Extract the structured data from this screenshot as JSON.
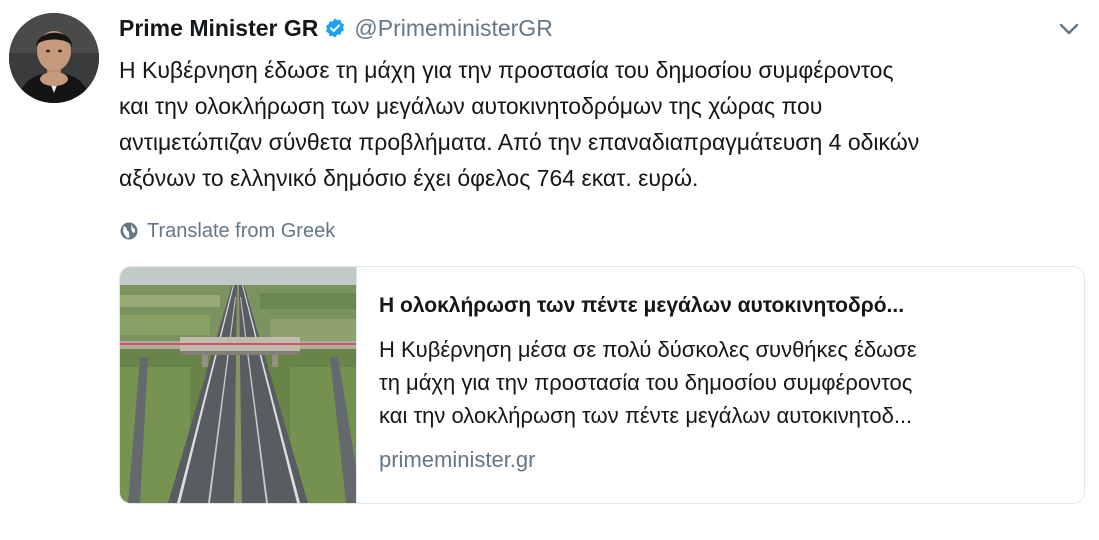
{
  "author": {
    "display_name": "Prime Minister GR",
    "handle": "@PrimeministerGR",
    "verified_icon": "verified-badge-icon",
    "avatar_icon": "profile-photo"
  },
  "menu": {
    "icon": "chevron-down-icon"
  },
  "tweet": {
    "lines": [
      "Η Κυβέρνηση έδωσε τη μάχη για την προστασία του δημοσίου συμφέροντος",
      "και την ολοκλήρωση των μεγάλων αυτοκινητοδρόμων της χώρας που",
      "αντιμετώπιζαν σύνθετα προβλήματα. Από την επαναδιαπραγμάτευση 4 οδικών",
      "αξόνων το ελληνικό δημόσιο έχει όφελος 764 εκατ. ευρώ."
    ]
  },
  "translate": {
    "label": "Translate from Greek",
    "icon": "globe-icon"
  },
  "card": {
    "title": "Η ολοκλήρωση των πέντε μεγάλων αυτοκινητοδρό...",
    "description_lines": [
      "Η Κυβέρνηση μέσα σε πολύ δύσκολες συνθήκες έδωσε",
      "τη μάχη για την προστασία του δημοσίου συμφέροντος",
      "και την ολοκλήρωση των πέντε μεγάλων αυτοκινητοδ..."
    ],
    "domain": "primeminister.gr",
    "image": "highway-aerial-photo"
  },
  "colors": {
    "text": "#14171a",
    "secondary": "#657786",
    "verified": "#1da1f2",
    "border": "#e1e8ed"
  }
}
